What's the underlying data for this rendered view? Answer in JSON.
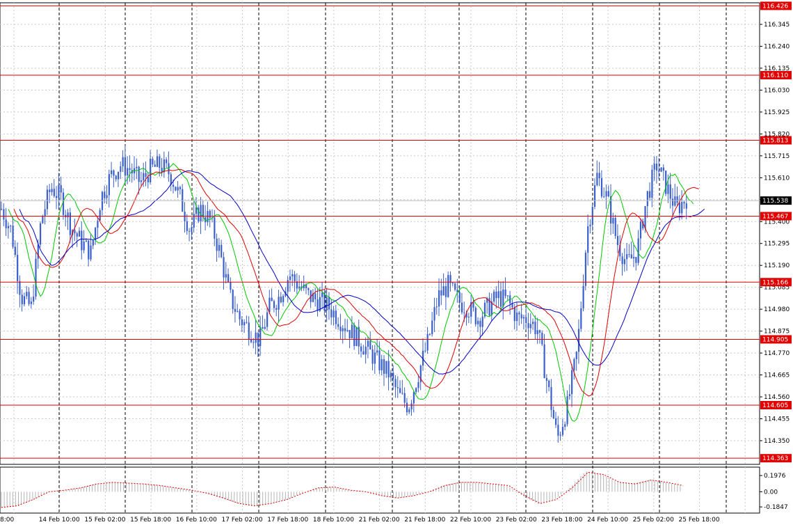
{
  "colors": {
    "background": "#ffffff",
    "candles": "#3a5fcd",
    "level_line": "#e00000",
    "level_label_bg": "#e00000",
    "grid": "#c8c8c8",
    "session_line": "#000000",
    "ma_fast": "#00c800",
    "ma_mid": "#e00000",
    "ma_slow": "#0000c8",
    "osc_signal": "#e00000",
    "osc_hist": "#b4b4b4",
    "current_price_bg": "#000000"
  },
  "chart_data": {
    "type": "candlestick",
    "y_ticks": [
      "116.345",
      "116.240",
      "116.135",
      "116.030",
      "115.925",
      "115.820",
      "115.715",
      "115.610",
      "115.505",
      "115.400",
      "115.295",
      "115.190",
      "115.085",
      "114.980",
      "114.875",
      "114.770",
      "114.665",
      "114.560",
      "114.455",
      "114.350"
    ],
    "ylim": [
      114.335,
      116.44
    ],
    "x_tick_labels": [
      "8:00",
      "14 Feb 10:00",
      "15 Feb 02:00",
      "15 Feb 18:00",
      "16 Feb 10:00",
      "17 Feb 02:00",
      "17 Feb 18:00",
      "18 Feb 10:00",
      "21 Feb 02:00",
      "21 Feb 18:00",
      "22 Feb 10:00",
      "23 Feb 02:00",
      "23 Feb 18:00",
      "24 Feb 10:00",
      "25 Feb 02:00",
      "25 Feb 18:00"
    ],
    "levels": [
      116.426,
      116.11,
      115.813,
      115.467,
      115.166,
      114.905,
      114.605,
      114.363
    ],
    "level_labels": [
      "116.426",
      "116.110",
      "115.813",
      "115.467",
      "115.166",
      "114.905",
      "114.605",
      "114.363"
    ],
    "current_price": 115.538,
    "current_price_label": "115.538",
    "price_path": [
      115.5,
      115.4,
      115.1,
      115.05,
      115.45,
      115.6,
      115.55,
      115.42,
      115.35,
      115.3,
      115.55,
      115.65,
      115.7,
      115.68,
      115.62,
      115.68,
      115.7,
      115.66,
      115.55,
      115.4,
      115.5,
      115.45,
      115.3,
      115.1,
      115.0,
      114.95,
      114.9,
      115.05,
      115.1,
      115.2,
      115.15,
      115.1,
      115.08,
      115.05,
      115.0,
      114.95,
      114.9,
      114.85,
      114.8,
      114.75,
      114.65,
      114.6,
      114.75,
      114.9,
      115.1,
      115.15,
      115.08,
      115.05,
      115.0,
      115.05,
      115.1,
      115.08,
      115.0,
      115.0,
      114.95,
      114.7,
      114.45,
      114.6,
      114.85,
      115.4,
      115.65,
      115.55,
      115.35,
      115.25,
      115.3,
      115.55,
      115.7,
      115.6,
      115.5,
      115.55
    ],
    "osc": {
      "y_ticks": [
        "0.1976",
        "0.00",
        "-0.1847"
      ],
      "ylim": [
        -0.26,
        0.3
      ],
      "signal_path": [
        -0.2,
        -0.18,
        -0.1,
        0.0,
        0.02,
        0.05,
        0.1,
        0.12,
        0.11,
        0.1,
        0.08,
        0.05,
        0.02,
        -0.02,
        -0.08,
        -0.15,
        -0.18,
        -0.15,
        -0.1,
        -0.02,
        0.05,
        0.06,
        0.02,
        0.0,
        -0.05,
        -0.08,
        -0.05,
        0.0,
        0.08,
        0.12,
        0.12,
        0.1,
        0.08,
        -0.05,
        -0.15,
        -0.1,
        0.05,
        0.25,
        0.22,
        0.12,
        0.1,
        0.15,
        0.12,
        0.08
      ]
    }
  }
}
